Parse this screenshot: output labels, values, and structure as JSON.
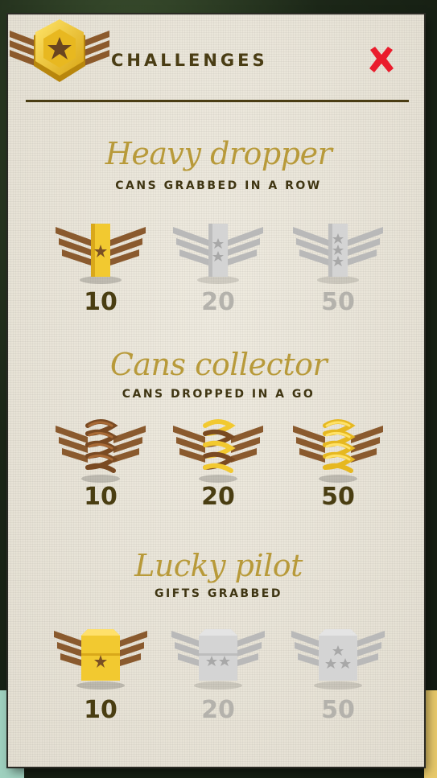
{
  "header": {
    "title": "CHALLENGES",
    "badge_icon": "gold-hexagon-star-wings-icon",
    "close_icon": "close-x-icon",
    "close_color": "#ea1c2c"
  },
  "colors": {
    "panel": "#e8e4d8",
    "title_gold": "#b89a3a",
    "dark_brown": "#4a3d14",
    "bronze": "#8a5a2e",
    "gold": "#f2c930",
    "silver": "#c8c8c8"
  },
  "challenges": [
    {
      "title": "Heavy dropper",
      "subtitle": "CANS GRABBED IN A ROW",
      "medals": [
        {
          "score": "10",
          "earned": true,
          "icon": "rank-bar-1-star-icon"
        },
        {
          "score": "20",
          "earned": false,
          "icon": "rank-bar-2-stars-icon"
        },
        {
          "score": "50",
          "earned": false,
          "icon": "rank-bar-3-stars-icon"
        }
      ]
    },
    {
      "title": "Cans collector",
      "subtitle": "CANS DROPPED IN A GO",
      "medals": [
        {
          "score": "10",
          "earned": true,
          "icon": "spiral-bronze-icon"
        },
        {
          "score": "20",
          "earned": true,
          "icon": "spiral-half-gold-icon"
        },
        {
          "score": "50",
          "earned": true,
          "icon": "spiral-gold-icon"
        }
      ]
    },
    {
      "title": "Lucky pilot",
      "subtitle": "GIFTS GRABBED",
      "medals": [
        {
          "score": "10",
          "earned": true,
          "icon": "gift-box-1-star-icon"
        },
        {
          "score": "20",
          "earned": false,
          "icon": "gift-box-2-stars-icon"
        },
        {
          "score": "50",
          "earned": false,
          "icon": "gift-box-3-stars-icon"
        }
      ]
    }
  ]
}
